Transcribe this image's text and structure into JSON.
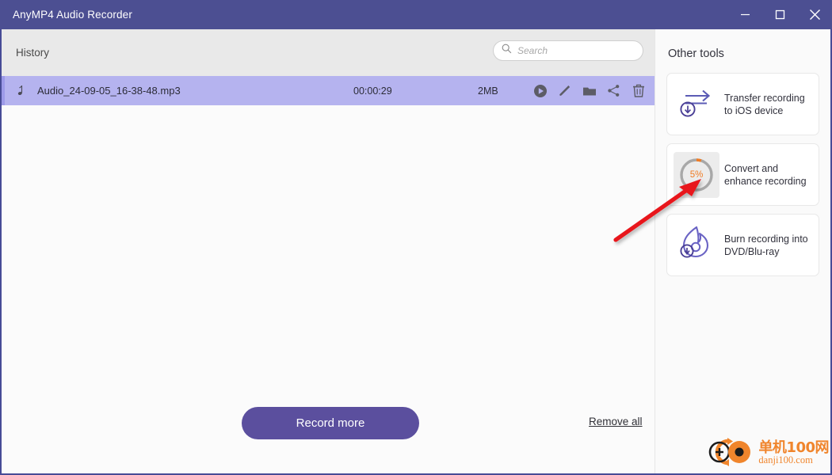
{
  "window": {
    "title": "AnyMP4 Audio Recorder",
    "accent_color": "#4c4f92",
    "controls": {
      "minimize": "minimize-button",
      "maximize": "maximize-button",
      "close": "close-button"
    }
  },
  "history": {
    "label": "History",
    "search": {
      "placeholder": "Search",
      "value": ""
    },
    "rows": [
      {
        "icon": "music-note-icon",
        "name": "Audio_24-09-05_16-38-48.mp3",
        "duration": "00:00:29",
        "size": "2MB",
        "selected": true,
        "actions": [
          "play-icon",
          "edit-icon",
          "folder-icon",
          "share-icon",
          "trash-icon"
        ]
      }
    ]
  },
  "bottom": {
    "record_more_label": "Record more",
    "remove_all_label": "Remove all"
  },
  "right_panel": {
    "title": "Other tools",
    "cards": [
      {
        "icon": "transfer-arrows-download-icon",
        "label": "Transfer recording\nto iOS device",
        "hovered": false
      },
      {
        "icon": "progress-ring-icon",
        "label": "Convert and\nenhance recording",
        "hovered": true,
        "progress_percent": "5%",
        "progress_value": 5,
        "progress_color": "#f07c25",
        "track_color": "#a8a8a8"
      },
      {
        "icon": "burn-disc-flame-download-icon",
        "label": "Burn recording into\nDVD/Blu-ray",
        "hovered": false
      }
    ]
  },
  "annotation": {
    "arrow": "red-pointer-arrow",
    "color": "#e8161a"
  },
  "watermark": {
    "cn": "单机100网",
    "en": "danji100.com",
    "color": "#f0852c"
  }
}
